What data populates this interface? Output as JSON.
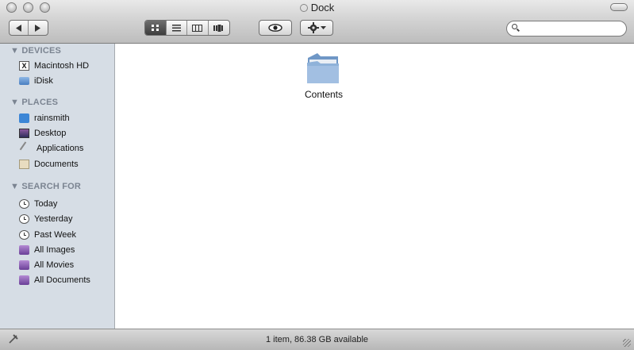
{
  "window": {
    "title": "Dock"
  },
  "search": {
    "value": "",
    "placeholder": ""
  },
  "sidebar": {
    "sections": [
      {
        "heading": "DEVICES",
        "items": [
          {
            "label": "Macintosh HD",
            "icon": "hard-drive-icon"
          },
          {
            "label": "iDisk",
            "icon": "idisk-icon"
          }
        ]
      },
      {
        "heading": "PLACES",
        "items": [
          {
            "label": "rainsmith",
            "icon": "home-icon"
          },
          {
            "label": "Desktop",
            "icon": "desktop-icon"
          },
          {
            "label": "Applications",
            "icon": "applications-icon"
          },
          {
            "label": "Documents",
            "icon": "documents-icon"
          }
        ]
      },
      {
        "heading": "SEARCH FOR",
        "items": [
          {
            "label": "Today",
            "icon": "clock-icon"
          },
          {
            "label": "Yesterday",
            "icon": "clock-icon"
          },
          {
            "label": "Past Week",
            "icon": "clock-icon"
          },
          {
            "label": "All Images",
            "icon": "smart-folder-icon"
          },
          {
            "label": "All Movies",
            "icon": "smart-folder-icon"
          },
          {
            "label": "All Documents",
            "icon": "smart-folder-icon"
          }
        ]
      }
    ]
  },
  "content": {
    "items": [
      {
        "label": "Contents",
        "icon": "folder-icon"
      }
    ]
  },
  "status": {
    "text": "1 item, 86.38 GB available"
  },
  "colors": {
    "sidebar_bg": "#d6dde5",
    "section_heading": "#7b8491",
    "folder_blue": "#8fb2d9"
  }
}
